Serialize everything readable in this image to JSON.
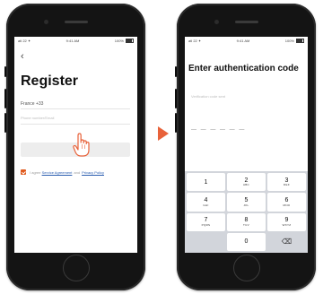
{
  "left_screen": {
    "status": {
      "carrier": "atl 22 ✦",
      "time": "9:41 AM",
      "battery": "100%"
    },
    "back_glyph": "‹",
    "title": "Register",
    "country": "France +33",
    "input_hint": "Phone number/Email",
    "button_label": "",
    "agreement": {
      "prefix": "I agree",
      "terms_link": "Service Agreement",
      "separator": "and",
      "privacy_link": "Privacy Policy"
    }
  },
  "arrow_color": "#e8623a",
  "accent_color": "#e05a1e",
  "right_screen": {
    "status": {
      "carrier": "atl 22 ✦",
      "time": "9:41 AM",
      "battery": "100%"
    },
    "title": "Enter authentication code",
    "code_hint": "Verification code sent",
    "code_placeholder": "— — — — — —",
    "keypad": [
      {
        "digit": "1",
        "letters": ""
      },
      {
        "digit": "2",
        "letters": "ABC"
      },
      {
        "digit": "3",
        "letters": "DEF"
      },
      {
        "digit": "4",
        "letters": "GHI"
      },
      {
        "digit": "5",
        "letters": "JKL"
      },
      {
        "digit": "6",
        "letters": "MNO"
      },
      {
        "digit": "7",
        "letters": "PQRS"
      },
      {
        "digit": "8",
        "letters": "TUV"
      },
      {
        "digit": "9",
        "letters": "WXYZ"
      },
      {
        "digit": "",
        "letters": ""
      },
      {
        "digit": "0",
        "letters": ""
      },
      {
        "digit": "⌫",
        "letters": ""
      }
    ]
  }
}
